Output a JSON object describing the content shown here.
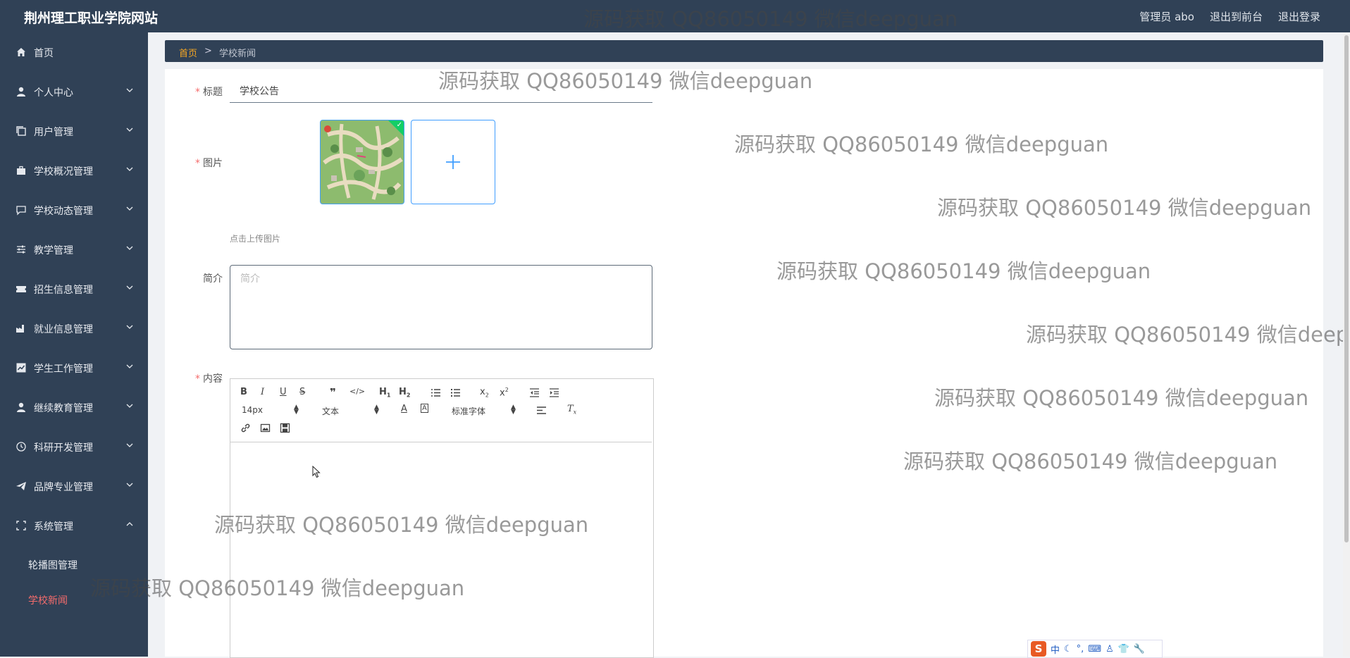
{
  "header": {
    "site_title": "荆州理工职业学院网站",
    "admin_label": "管理员 abo",
    "exit_front": "退出到前台",
    "logout": "退出登录"
  },
  "sidebar": {
    "items": [
      {
        "label": "首页",
        "icon": "home-icon"
      },
      {
        "label": "个人中心",
        "icon": "user-icon"
      },
      {
        "label": "用户管理",
        "icon": "copy-icon"
      },
      {
        "label": "学校概况管理",
        "icon": "briefcase-icon"
      },
      {
        "label": "学校动态管理",
        "icon": "chat-icon"
      },
      {
        "label": "教学管理",
        "icon": "sliders-icon"
      },
      {
        "label": "招生信息管理",
        "icon": "ticket-icon"
      },
      {
        "label": "就业信息管理",
        "icon": "factory-icon"
      },
      {
        "label": "学生工作管理",
        "icon": "chart-icon"
      },
      {
        "label": "继续教育管理",
        "icon": "user-icon"
      },
      {
        "label": "科研开发管理",
        "icon": "clock-icon"
      },
      {
        "label": "品牌专业管理",
        "icon": "send-icon"
      },
      {
        "label": "系统管理",
        "icon": "fullscreen-icon"
      }
    ],
    "sub_items": [
      "轮播图管理",
      "学校新闻"
    ]
  },
  "breadcrumb": {
    "home": "首页",
    "separator": ">",
    "current": "学校新闻"
  },
  "form": {
    "title_label": "标题",
    "title_value": "学校公告",
    "image_label": "图片",
    "upload_hint": "点击上传图片",
    "summary_label": "简介",
    "summary_placeholder": "简介",
    "content_label": "内容"
  },
  "editor": {
    "font_size": "14px",
    "header_select": "文本",
    "font_family": "标准字体"
  },
  "watermark_text": "源码获取 QQ86050149 微信deepguan",
  "ime": {
    "logo": "S",
    "mode": "中"
  },
  "colors": {
    "sidebar_bg": "#304156",
    "accent": "#409eff",
    "active_menu": "#f56c6c",
    "breadcrumb_home": "#f5a623"
  }
}
